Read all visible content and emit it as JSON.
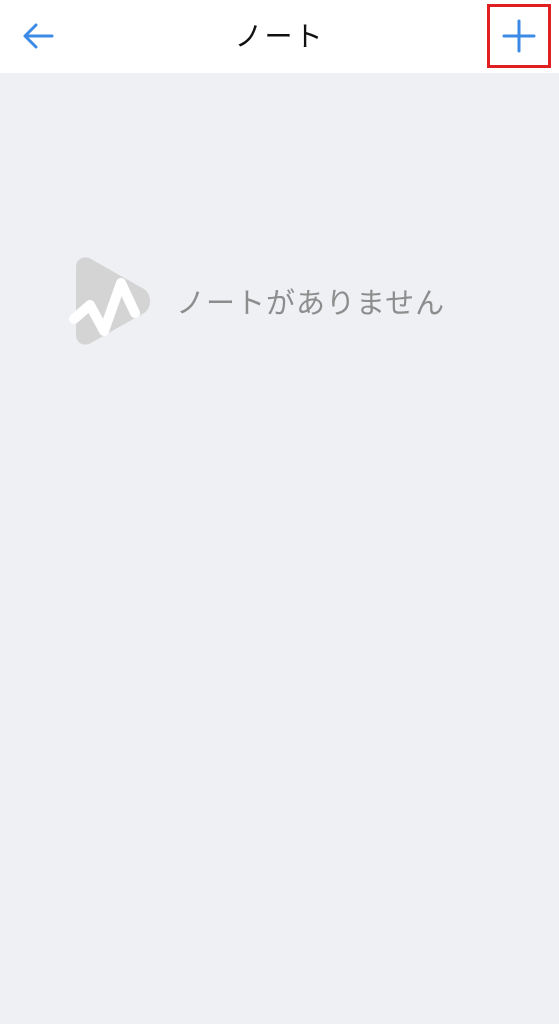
{
  "header": {
    "title": "ノート",
    "back_icon": "arrow-left-icon",
    "add_icon": "plus-icon",
    "accent_color": "#3b8ae6",
    "highlight_color": "#e02020"
  },
  "empty_state": {
    "message": "ノートがありません",
    "logo_icon": "app-logo-icon"
  },
  "colors": {
    "header_background": "#ffffff",
    "page_background": "#eff0f4",
    "muted_text": "#8d8d8d"
  }
}
